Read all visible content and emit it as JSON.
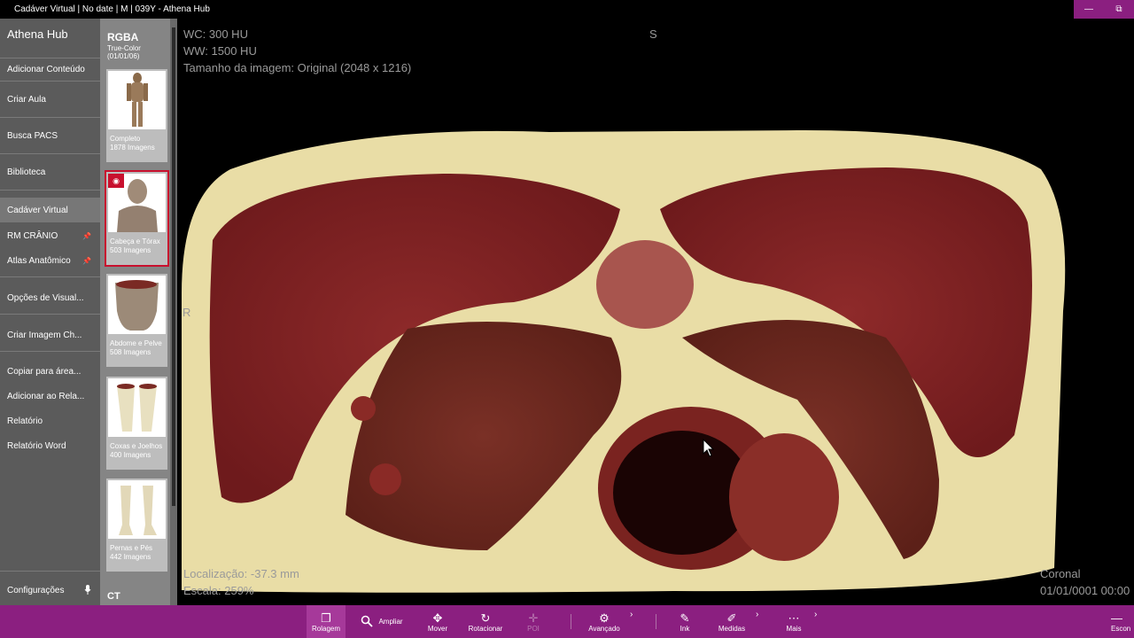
{
  "window": {
    "title": "Cadáver Virtual | No date | M | 039Y - Athena Hub",
    "minimize": "—",
    "restore": "⧉"
  },
  "sidebar": {
    "hub_title": "Athena Hub",
    "items": [
      {
        "label": "Adicionar Conteúdo"
      },
      {
        "label": "Criar Aula"
      },
      {
        "label": "Busca PACS"
      },
      {
        "label": "Biblioteca"
      },
      {
        "label": "Cadáver Virtual"
      },
      {
        "label": "RM CRÂNIO",
        "pin": "📌"
      },
      {
        "label": "Atlas Anatômico",
        "pin": "📌"
      },
      {
        "label": "Opções de Visual..."
      },
      {
        "label": "Criar Imagem Ch..."
      },
      {
        "label": "Copiar para área..."
      },
      {
        "label": "Adicionar ao Rela..."
      },
      {
        "label": "Relatório"
      },
      {
        "label": "Relatório Word"
      },
      {
        "label": "Configurações"
      }
    ]
  },
  "series_panel": {
    "header": "RGBA",
    "subheader": "True-Color (01/01/06)",
    "thumbnails": [
      {
        "name": "Completo",
        "count": "1878 Imagens"
      },
      {
        "name": "Cabeça e Tórax",
        "count": "503 Imagens"
      },
      {
        "name": "Abdome e Pelve",
        "count": "508 Imagens"
      },
      {
        "name": "Coxas e Joelhos",
        "count": "400 Imagens"
      },
      {
        "name": "Pernas e Pés",
        "count": "442 Imagens"
      }
    ],
    "footer": "CT"
  },
  "viewer": {
    "wc": "WC: 300 HU",
    "ww": "WW: 1500 HU",
    "image_size": "Tamanho da imagem: Original (2048 x 1216)",
    "orientation_top": "S",
    "orientation_left": "R",
    "location": "Localização: -37.3 mm",
    "scale": "Escala: 259%",
    "plane": "Coronal",
    "date": "01/01/0001 00:00"
  },
  "toolbar": {
    "tools": [
      {
        "label": "Rolagem",
        "icon": "stack-icon"
      },
      {
        "label": "Ampliar",
        "icon": "magnify-icon"
      },
      {
        "label": "Mover",
        "icon": "move-icon"
      },
      {
        "label": "Rotacionar",
        "icon": "rotate-icon"
      },
      {
        "label": "POI",
        "icon": "crosshair-icon"
      },
      {
        "label": "Avançado",
        "icon": "gear-icon"
      },
      {
        "label": "Ink",
        "icon": "pen-icon"
      },
      {
        "label": "Medidas",
        "icon": "ruler-icon"
      },
      {
        "label": "Mais",
        "icon": "more-icon"
      },
      {
        "label": "Escon",
        "icon": "hide-icon"
      }
    ]
  },
  "colors": {
    "accent": "#8b1f80",
    "sidebar": "#5b5b5b",
    "panel": "#858585",
    "selected": "#c8102e"
  }
}
